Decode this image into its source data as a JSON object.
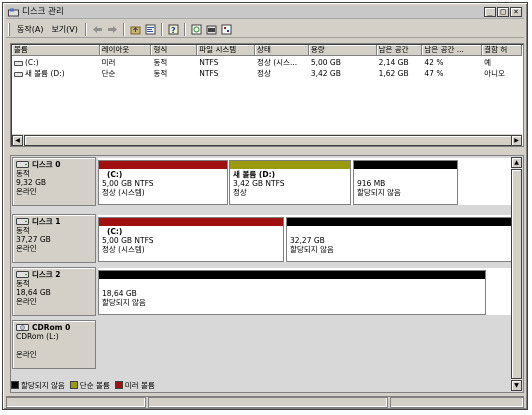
{
  "window": {
    "title": "디스크 관리"
  },
  "menu": {
    "action": "동작(A)",
    "view": "보기(V)"
  },
  "toolbar": {
    "icons": [
      "back-arrow-icon",
      "forward-arrow-icon",
      "folder-up-icon",
      "properties-icon",
      "help-icon",
      "refresh-icon",
      "rescan-icon",
      "settings-icon"
    ]
  },
  "volume_list": {
    "columns": [
      "볼륨",
      "레이아웃",
      "형식",
      "파일 시스템",
      "상태",
      "용량",
      "남은 공간",
      "남은 공간 ...",
      "결함 허"
    ],
    "rows": [
      [
        "(C:)",
        "미러",
        "동적",
        "NTFS",
        "정상 (시스...",
        "5,00 GB",
        "2,14 GB",
        "42 %",
        "예"
      ],
      [
        "새 볼륨 (D:)",
        "단순",
        "동적",
        "NTFS",
        "정상",
        "3,42 GB",
        "1,62 GB",
        "47 %",
        "아니오"
      ]
    ]
  },
  "disks": [
    {
      "name": "디스크 0",
      "type": "동적",
      "size": "9,32 GB",
      "status": "온라인",
      "partitions": [
        {
          "name": "(C:)",
          "line1": "5,00 GB NTFS",
          "line2": "정상 (시스템)",
          "color": "#a01010"
        },
        {
          "name": "새 볼륨  (D:)",
          "line1": "3,42 GB NTFS",
          "line2": "정상",
          "color": "#9a9a10"
        },
        {
          "name": "",
          "line1": "916 MB",
          "line2": "할당되지 않음",
          "color": "#000000"
        }
      ]
    },
    {
      "name": "디스크 1",
      "type": "동적",
      "size": "37,27 GB",
      "status": "온라인",
      "partitions": [
        {
          "name": "(C:)",
          "line1": "5,00 GB NTFS",
          "line2": "정상 (시스템)",
          "color": "#a01010"
        },
        {
          "name": "",
          "line1": "32,27 GB",
          "line2": "할당되지 않음",
          "color": "#000000"
        }
      ]
    },
    {
      "name": "디스크 2",
      "type": "동적",
      "size": "18,64 GB",
      "status": "온라인",
      "partitions": [
        {
          "name": "",
          "line1": "18,64 GB",
          "line2": "할당되지 않음",
          "color": "#000000"
        }
      ]
    },
    {
      "name": "CDRom 0",
      "type": "CDRom (L:)",
      "size": "",
      "status": "온라인",
      "partitions": []
    }
  ],
  "legend": [
    {
      "label": "할당되지 않음",
      "color": "#000000"
    },
    {
      "label": "단순 볼륨",
      "color": "#9a9a10"
    },
    {
      "label": "미러 볼륨",
      "color": "#a01010"
    }
  ]
}
